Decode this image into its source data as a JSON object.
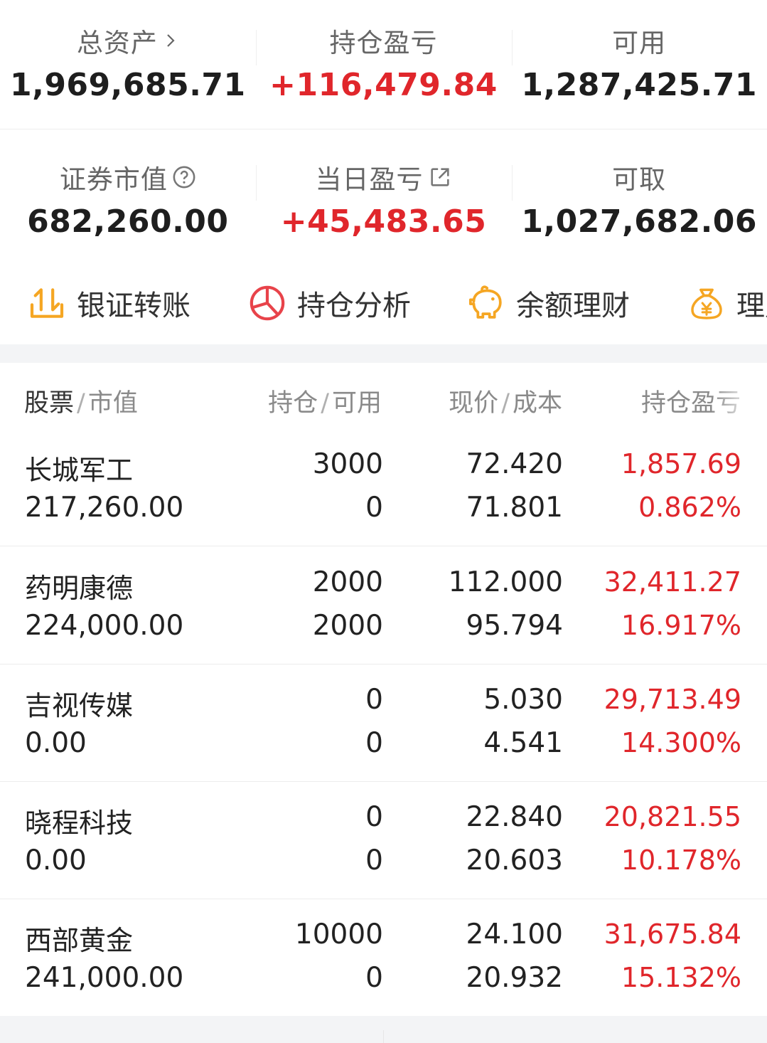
{
  "summary": {
    "total_assets": {
      "label": "总资产",
      "value": "1,969,685.71"
    },
    "position_pnl": {
      "label": "持仓盈亏",
      "value": "+116,479.84"
    },
    "available": {
      "label": "可用",
      "value": "1,287,425.71"
    },
    "market_value": {
      "label": "证券市值",
      "value": "682,260.00"
    },
    "daily_pnl": {
      "label": "当日盈亏",
      "value": "+45,483.65"
    },
    "withdrawable": {
      "label": "可取",
      "value": "1,027,682.06"
    }
  },
  "actions": [
    {
      "label": "银证转账",
      "icon": "transfer-icon"
    },
    {
      "label": "持仓分析",
      "icon": "pie-chart-icon"
    },
    {
      "label": "余额理财",
      "icon": "piggy-bank-icon"
    },
    {
      "label": "理财",
      "icon": "money-bag-icon"
    }
  ],
  "table": {
    "headers": {
      "col1": {
        "main": "股票",
        "sub": "市值"
      },
      "col2": {
        "main": "持仓",
        "sub": "可用"
      },
      "col3": {
        "main": "现价",
        "sub": "成本"
      },
      "col4": {
        "main": "持仓盈亏"
      }
    },
    "rows": [
      {
        "name": "长城军工",
        "market_value": "217,260.00",
        "position": "3000",
        "available": "0",
        "price": "72.420",
        "cost": "71.801",
        "pnl": "1,857.69",
        "pnl_pct": "0.862%"
      },
      {
        "name": "药明康德",
        "market_value": "224,000.00",
        "position": "2000",
        "available": "2000",
        "price": "112.000",
        "cost": "95.794",
        "pnl": "32,411.27",
        "pnl_pct": "16.917%"
      },
      {
        "name": "吉视传媒",
        "market_value": "0.00",
        "position": "0",
        "available": "0",
        "price": "5.030",
        "cost": "4.541",
        "pnl": "29,713.49",
        "pnl_pct": "14.300%"
      },
      {
        "name": "晓程科技",
        "market_value": "0.00",
        "position": "0",
        "available": "0",
        "price": "22.840",
        "cost": "20.603",
        "pnl": "20,821.55",
        "pnl_pct": "10.178%"
      },
      {
        "name": "西部黄金",
        "market_value": "241,000.00",
        "position": "10000",
        "available": "0",
        "price": "24.100",
        "cost": "20.932",
        "pnl": "31,675.84",
        "pnl_pct": "15.132%"
      }
    ]
  },
  "colors": {
    "red": "#e0262b",
    "orange": "#f5a623",
    "label": "#666666"
  }
}
